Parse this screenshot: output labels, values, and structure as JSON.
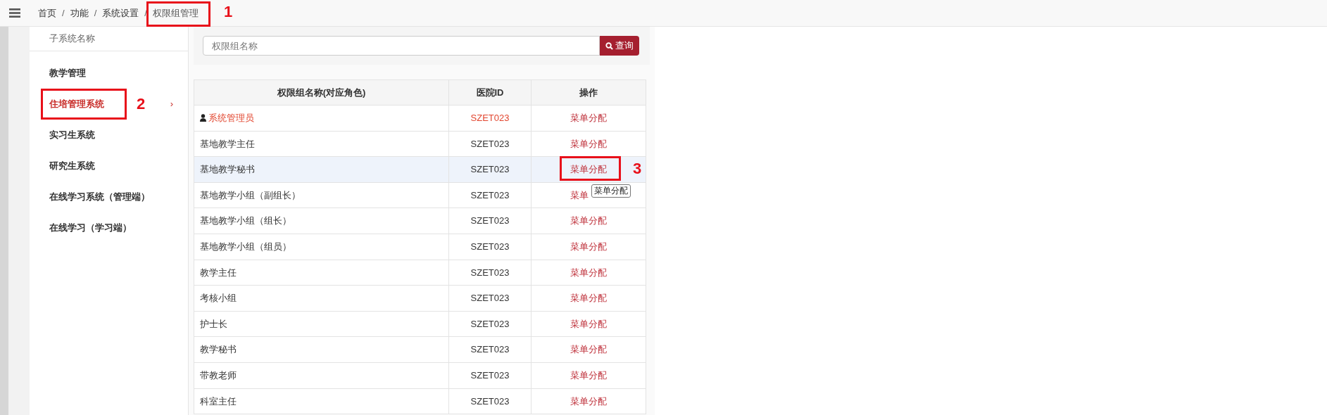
{
  "breadcrumb_separator": "/",
  "sidebar_chevron": "›",
  "breadcrumb": [
    {
      "label": "首页",
      "current": false
    },
    {
      "label": "功能",
      "current": false
    },
    {
      "label": "系统设置",
      "current": false
    },
    {
      "label": "权限组管理",
      "current": true
    }
  ],
  "sidebar": {
    "title": "子系统名称",
    "items": [
      {
        "label": "教学管理",
        "selected": false
      },
      {
        "label": "住培管理系统",
        "selected": true
      },
      {
        "label": "实习生系统",
        "selected": false
      },
      {
        "label": "研究生系统",
        "selected": false
      },
      {
        "label": "在线学习系统（管理端）",
        "selected": false
      },
      {
        "label": "在线学习（学习端）",
        "selected": false
      }
    ]
  },
  "search": {
    "placeholder": "权限组名称",
    "button": "查询"
  },
  "table": {
    "columns": [
      "权限组名称(对应角色)",
      "医院ID",
      "操作"
    ],
    "rows": [
      {
        "name": "系统管理员",
        "hospital_id": "SZET023",
        "action": "菜单分配",
        "admin": true,
        "hovered": false
      },
      {
        "name": "基地教学主任",
        "hospital_id": "SZET023",
        "action": "菜单分配",
        "admin": false,
        "hovered": false
      },
      {
        "name": "基地教学秘书",
        "hospital_id": "SZET023",
        "action": "菜单分配",
        "admin": false,
        "hovered": true
      },
      {
        "name": "基地教学小组（副组长）",
        "hospital_id": "SZET023",
        "action": "菜单",
        "admin": false,
        "hovered": false
      },
      {
        "name": "基地教学小组（组长）",
        "hospital_id": "SZET023",
        "action": "菜单分配",
        "admin": false,
        "hovered": false
      },
      {
        "name": "基地教学小组（组员）",
        "hospital_id": "SZET023",
        "action": "菜单分配",
        "admin": false,
        "hovered": false
      },
      {
        "name": "教学主任",
        "hospital_id": "SZET023",
        "action": "菜单分配",
        "admin": false,
        "hovered": false
      },
      {
        "name": "考核小组",
        "hospital_id": "SZET023",
        "action": "菜单分配",
        "admin": false,
        "hovered": false
      },
      {
        "name": "护士长",
        "hospital_id": "SZET023",
        "action": "菜单分配",
        "admin": false,
        "hovered": false
      },
      {
        "name": "教学秘书",
        "hospital_id": "SZET023",
        "action": "菜单分配",
        "admin": false,
        "hovered": false
      },
      {
        "name": "带教老师",
        "hospital_id": "SZET023",
        "action": "菜单分配",
        "admin": false,
        "hovered": false
      },
      {
        "name": "科室主任",
        "hospital_id": "SZET023",
        "action": "菜单分配",
        "admin": false,
        "hovered": false
      }
    ]
  },
  "tooltip": "菜单分配",
  "annotations": [
    {
      "label": "1"
    },
    {
      "label": "2"
    },
    {
      "label": "3"
    }
  ]
}
